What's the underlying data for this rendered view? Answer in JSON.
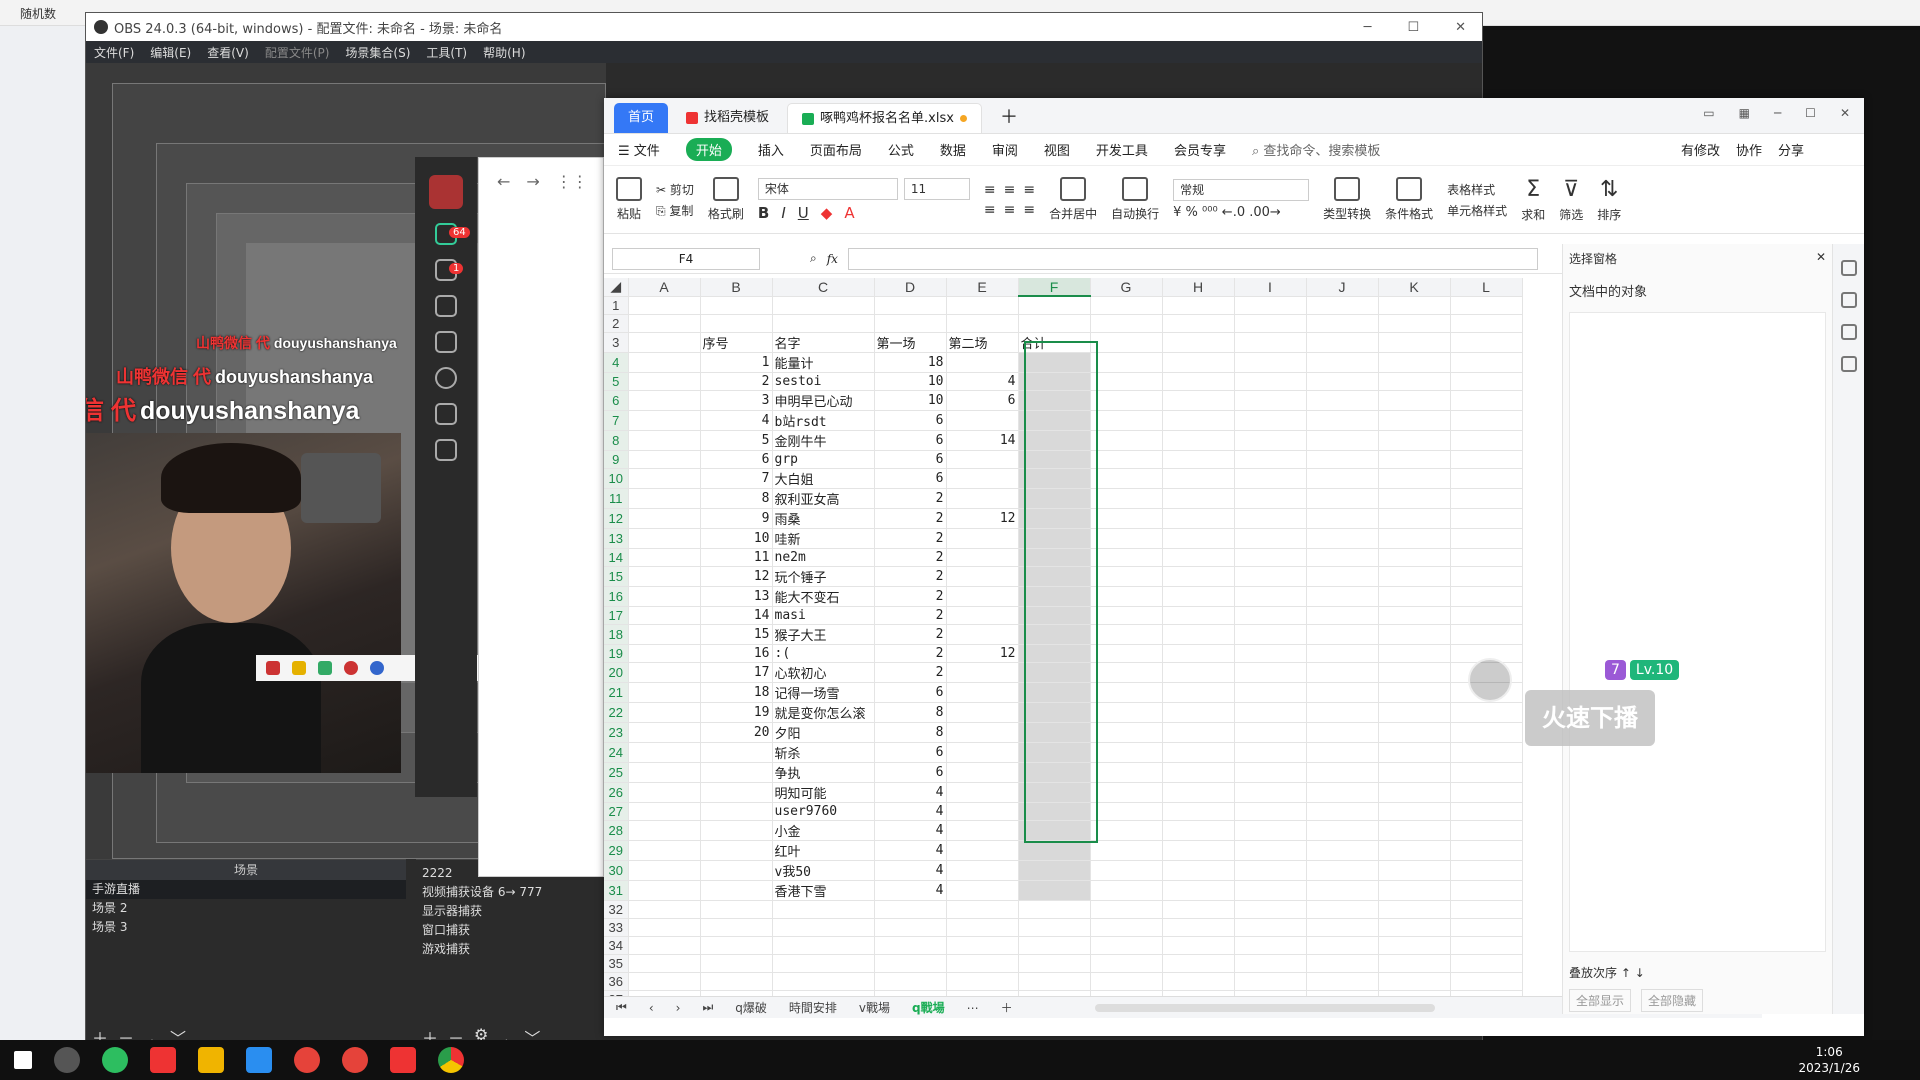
{
  "background": {
    "top_text": "随机数"
  },
  "obs": {
    "title": "OBS 24.0.3 (64-bit, windows) - 配置文件: 未命名 - 场景: 未命名",
    "menu": [
      "文件(F)",
      "编辑(E)",
      "查看(V)",
      "配置文件(P)",
      "场景集合(S)",
      "工具(T)",
      "帮助(H)"
    ],
    "scenes_header": "场景",
    "scenes": [
      "手游直播",
      "场景 2",
      "场景 3"
    ],
    "sources": [
      "2222",
      "视频捕获设备 6→ 777",
      "显示器捕获",
      "窗口捕获",
      "游戏捕获"
    ]
  },
  "overlay": {
    "watermark_zh": "山鸭微信 代",
    "watermark_id": "douyushanshanya",
    "live_text": "火速下播",
    "badge_level": "Lv.10",
    "badge_num": "7"
  },
  "side_app": {
    "badge_chat": "64",
    "badge_user": "1"
  },
  "wps": {
    "tabs": [
      "首页",
      "找稻壳模板",
      "啄鸭鸡杯报名名单.xlsx"
    ],
    "menu": [
      "文件",
      "开始",
      "插入",
      "页面布局",
      "公式",
      "数据",
      "审阅",
      "视图",
      "开发工具",
      "会员专享"
    ],
    "search_placeholder": "查找命令、搜索模板",
    "menu_right": [
      "有修改",
      "协作",
      "分享"
    ],
    "ribbon": {
      "paste": "粘贴",
      "cut": "剪切",
      "copy": "复制",
      "format_painter": "格式刷",
      "font": "宋体",
      "size": "11",
      "number_format": "常规",
      "merge": "合并居中",
      "wrap": "自动换行",
      "type_convert": "类型转换",
      "cond_format": "条件格式",
      "table_style": "表格样式",
      "cell_style": "单元格样式",
      "sum": "求和",
      "filter": "筛选",
      "sort": "排序"
    },
    "name_box": "F4",
    "fx": "fx",
    "columns": [
      "A",
      "B",
      "C",
      "D",
      "E",
      "F",
      "G",
      "H",
      "I",
      "J",
      "K",
      "L"
    ],
    "headers": {
      "seq": "序号",
      "name": "名字",
      "r1": "第一场",
      "r2": "第二场",
      "total": "合计"
    },
    "rows": [
      {
        "seq": "1",
        "name": "能量计",
        "r1": "18",
        "r2": ""
      },
      {
        "seq": "2",
        "name": "sestoi",
        "r1": "10",
        "r2": "4"
      },
      {
        "seq": "3",
        "name": "申明早已心动",
        "r1": "10",
        "r2": "6"
      },
      {
        "seq": "4",
        "name": "b站rsdt",
        "r1": "6",
        "r2": ""
      },
      {
        "seq": "5",
        "name": "金刚牛牛",
        "r1": "6",
        "r2": "14"
      },
      {
        "seq": "6",
        "name": "grp",
        "r1": "6",
        "r2": ""
      },
      {
        "seq": "7",
        "name": "大白姐",
        "r1": "6",
        "r2": ""
      },
      {
        "seq": "8",
        "name": "叙利亚女高",
        "r1": "2",
        "r2": ""
      },
      {
        "seq": "9",
        "name": "雨桑",
        "r1": "2",
        "r2": "12"
      },
      {
        "seq": "10",
        "name": "哇新",
        "r1": "2",
        "r2": ""
      },
      {
        "seq": "11",
        "name": "ne2m",
        "r1": "2",
        "r2": ""
      },
      {
        "seq": "12",
        "name": "玩个锤子",
        "r1": "2",
        "r2": ""
      },
      {
        "seq": "13",
        "name": "能大不变石",
        "r1": "2",
        "r2": ""
      },
      {
        "seq": "14",
        "name": "masi",
        "r1": "2",
        "r2": ""
      },
      {
        "seq": "15",
        "name": "猴子大王",
        "r1": "2",
        "r2": ""
      },
      {
        "seq": "16",
        "name": ":(",
        "r1": "2",
        "r2": "12"
      },
      {
        "seq": "17",
        "name": "心软初心",
        "r1": "2",
        "r2": ""
      },
      {
        "seq": "18",
        "name": "记得一场雪",
        "r1": "6",
        "r2": ""
      },
      {
        "seq": "19",
        "name": "就是变你怎么滚",
        "r1": "8",
        "r2": ""
      },
      {
        "seq": "20",
        "name": "夕阳",
        "r1": "8",
        "r2": ""
      },
      {
        "seq": "",
        "name": "斩杀",
        "r1": "6",
        "r2": ""
      },
      {
        "seq": "",
        "name": "争执",
        "r1": "6",
        "r2": ""
      },
      {
        "seq": "",
        "name": "明知可能",
        "r1": "4",
        "r2": ""
      },
      {
        "seq": "",
        "name": "user9760",
        "r1": "4",
        "r2": ""
      },
      {
        "seq": "",
        "name": "小金",
        "r1": "4",
        "r2": ""
      },
      {
        "seq": "",
        "name": "红叶",
        "r1": "4",
        "r2": ""
      },
      {
        "seq": "",
        "name": "v我50",
        "r1": "4",
        "r2": ""
      },
      {
        "seq": "",
        "name": "香港下雪",
        "r1": "4",
        "r2": ""
      }
    ],
    "sheet_tabs": [
      "q爆破",
      "時間安排",
      "v戰場",
      "q戰場"
    ],
    "active_sheet": "q戰場",
    "pane": {
      "title": "选择窗格",
      "subtitle": "文档中的对象",
      "order": "叠放次序",
      "show_all": "全部显示",
      "hide_all": "全部隐藏"
    }
  },
  "taskbar": {
    "time": "1:06",
    "date": "2023/1/26"
  }
}
